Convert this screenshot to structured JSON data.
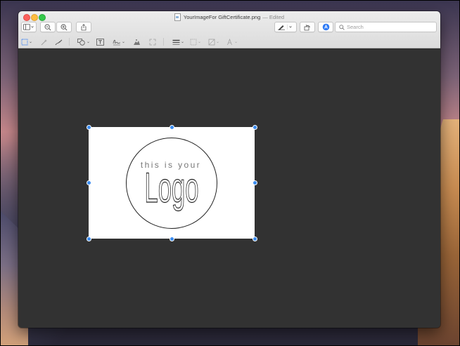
{
  "window": {
    "filename": "YourImageFor GiftCertificate.png",
    "edited_label": "— Edited"
  },
  "toolbar": {
    "sidebar_icon": "sidebar-icon",
    "zoom_out_icon": "zoom-out-icon",
    "zoom_in_icon": "zoom-in-icon",
    "share_icon": "share-icon",
    "pen_icon": "pen-icon",
    "rotate_icon": "rotate-icon",
    "markup_icon": "markup-icon"
  },
  "search": {
    "placeholder": "Search"
  },
  "markup_tools": [
    "rectangular-selection-icon",
    "instant-alpha-icon",
    "sketch-icon",
    "shapes-icon",
    "text-icon",
    "sign-icon",
    "adjust-color-icon",
    "adjust-size-icon",
    "shape-style-icon",
    "border-color-icon",
    "fill-color-icon",
    "text-style-icon"
  ],
  "image": {
    "logo_small_text": "this is your",
    "logo_big_text": "Logo"
  },
  "colors": {
    "canvas": "#323232",
    "selection_handle": "#3b8cf0",
    "titlebar": "#e4e4e4"
  }
}
